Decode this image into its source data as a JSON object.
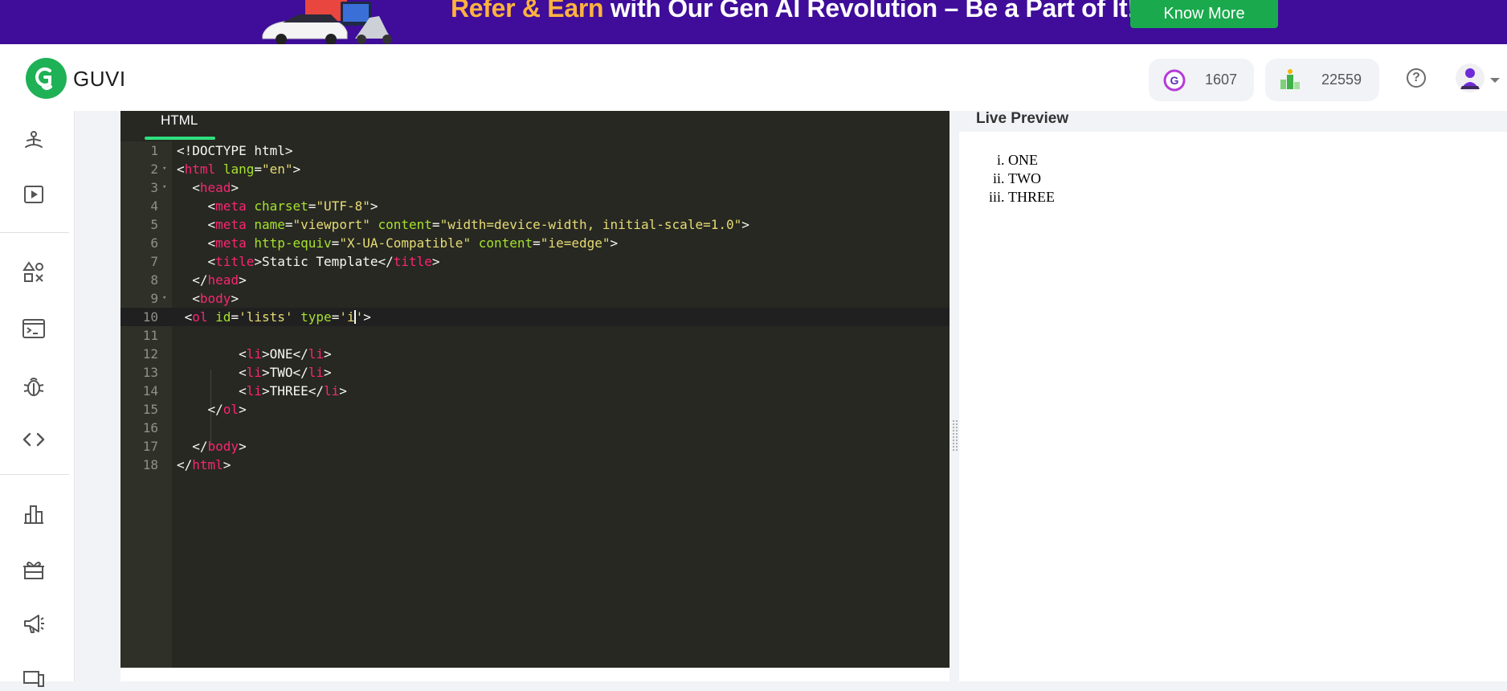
{
  "banner": {
    "headline_highlight": "Refer & Earn",
    "headline_rest": " with Our Gen AI Revolution – Be a Part of It!",
    "cta_label": "Know More",
    "colors": {
      "background": "#3f0d99",
      "highlight": "#ffb23f",
      "cta": "#1aa94d"
    }
  },
  "header": {
    "brand": "GUVI",
    "gems_icon": "g-coin-icon",
    "gems_count": "1607",
    "rank_icon": "leaderboard-icon",
    "rank_count": "22559",
    "help_glyph": "?"
  },
  "sidebar": {
    "items": [
      {
        "icon": "meditation-icon"
      },
      {
        "icon": "play-video-icon"
      },
      {
        "icon": "shapes-icon"
      },
      {
        "icon": "terminal-icon"
      },
      {
        "icon": "bug-icon"
      },
      {
        "icon": "code-brackets-icon"
      },
      {
        "icon": "bar-chart-icon"
      },
      {
        "icon": "gift-icon"
      },
      {
        "icon": "megaphone-icon"
      },
      {
        "icon": "devices-icon"
      }
    ]
  },
  "editor": {
    "tab_label": "HTML",
    "active_line": 10,
    "lines": [
      {
        "n": "1",
        "text": "<!DOCTYPE html>"
      },
      {
        "n": "2",
        "text": "<html lang=\"en\">"
      },
      {
        "n": "3",
        "text": "  <head>"
      },
      {
        "n": "4",
        "text": "    <meta charset=\"UTF-8\">"
      },
      {
        "n": "5",
        "text": "    <meta name=\"viewport\" content=\"width=device-width, initial-scale=1.0\">"
      },
      {
        "n": "6",
        "text": "    <meta http-equiv=\"X-UA-Compatible\" content=\"ie=edge\">"
      },
      {
        "n": "7",
        "text": "    <title>Static Template</title>"
      },
      {
        "n": "8",
        "text": "  </head>"
      },
      {
        "n": "9",
        "text": "  <body>"
      },
      {
        "n": "10",
        "text": " <ol id='lists' type='i'>"
      },
      {
        "n": "11",
        "text": ""
      },
      {
        "n": "12",
        "text": "        <li>ONE</li>"
      },
      {
        "n": "13",
        "text": "        <li>TWO</li>"
      },
      {
        "n": "14",
        "text": "        <li>THREE</li>"
      },
      {
        "n": "15",
        "text": "    </ol>"
      },
      {
        "n": "16",
        "text": ""
      },
      {
        "n": "17",
        "text": "  </body>"
      },
      {
        "n": "18",
        "text": "</html>"
      }
    ]
  },
  "preview": {
    "title": "Live Preview",
    "list_type": "i",
    "items": [
      "ONE",
      "TWO",
      "THREE"
    ]
  }
}
